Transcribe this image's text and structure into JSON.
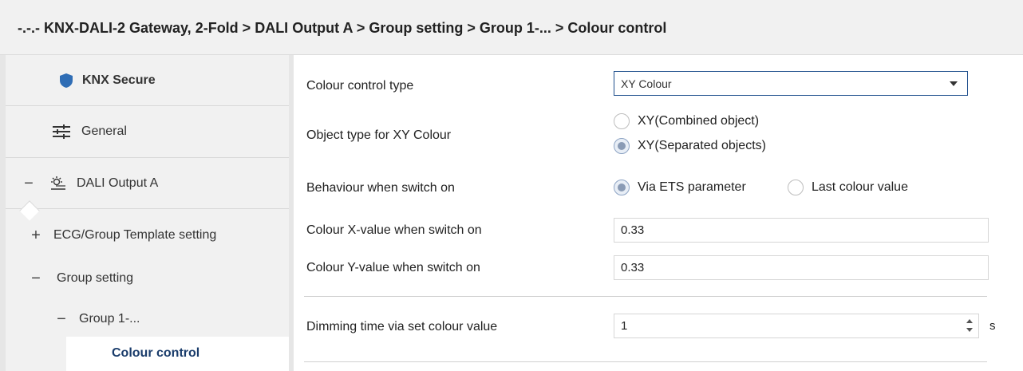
{
  "breadcrumb": "-.-.- KNX-DALI-2 Gateway, 2-Fold > DALI Output A > Group setting > Group 1-... > Colour control",
  "sidebar": {
    "items": [
      {
        "label": "KNX Secure",
        "icon": "shield-icon"
      },
      {
        "label": "General",
        "icon": "sliders-icon"
      },
      {
        "label": "DALI Output A",
        "icon": "lamp-icon",
        "toggle": "−"
      },
      {
        "label": "ECG/Group Template setting",
        "toggle": "+"
      },
      {
        "label": "Group setting",
        "toggle": "−"
      },
      {
        "label": "Group 1-...",
        "toggle": "−"
      },
      {
        "label": "Colour control"
      }
    ]
  },
  "params": {
    "colour_control_type": {
      "label": "Colour control type",
      "value": "XY Colour"
    },
    "object_type": {
      "label": "Object type for XY Colour",
      "options": [
        "XY(Combined object)",
        "XY(Separated objects)"
      ],
      "selected": "XY(Separated objects)"
    },
    "behaviour_switch_on": {
      "label": "Behaviour when switch on",
      "options": [
        "Via ETS parameter",
        "Last colour value"
      ],
      "selected": "Via ETS parameter"
    },
    "colour_x": {
      "label": "Colour X-value when switch on",
      "value": "0.33"
    },
    "colour_y": {
      "label": "Colour Y-value when switch on",
      "value": "0.33"
    },
    "dimming_time": {
      "label": "Dimming time via set colour value",
      "value": "1",
      "unit": "s"
    }
  },
  "colors": {
    "accent": "#1e4e8c",
    "active_text": "#1a3c6b",
    "shield": "#2f6db5"
  }
}
